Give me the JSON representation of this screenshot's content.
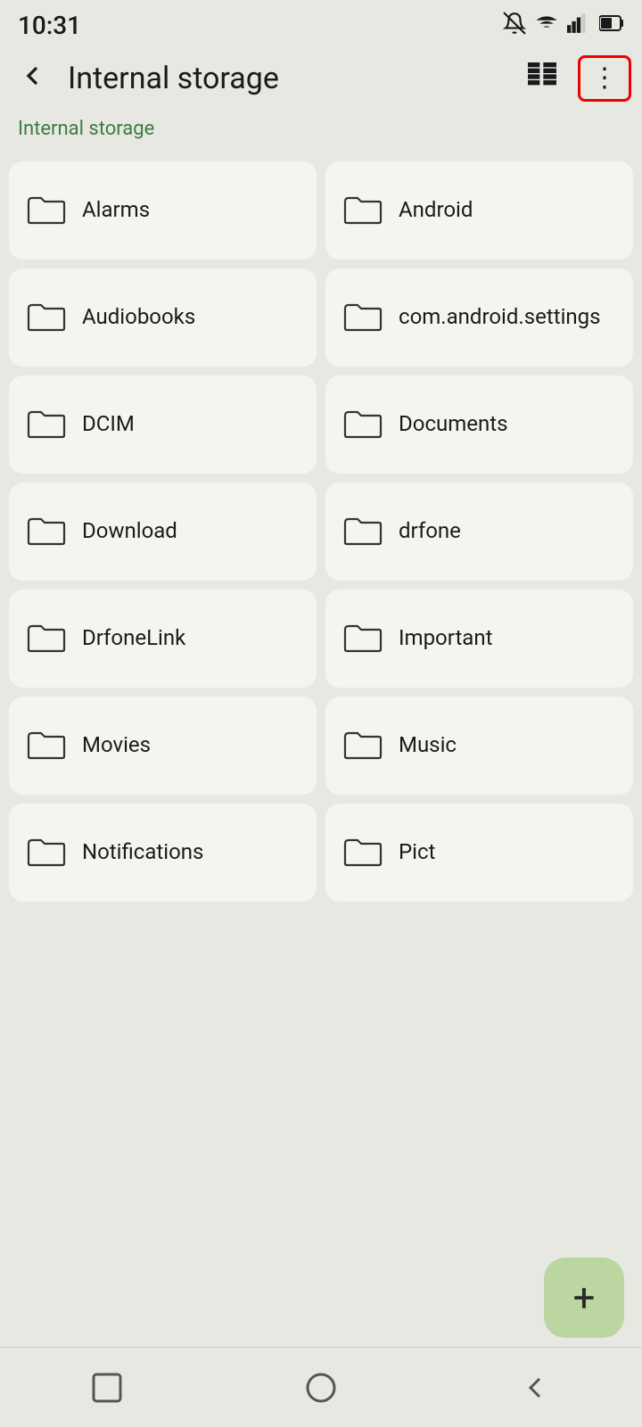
{
  "status": {
    "time": "10:31"
  },
  "topbar": {
    "back_label": "←",
    "title": "Internal storage",
    "more_icon": "⋮"
  },
  "breadcrumb": {
    "text": "Internal storage"
  },
  "folders": [
    {
      "name": "Alarms"
    },
    {
      "name": "Android"
    },
    {
      "name": "Audiobooks"
    },
    {
      "name": "com.android.settings"
    },
    {
      "name": "DCIM"
    },
    {
      "name": "Documents"
    },
    {
      "name": "Download"
    },
    {
      "name": "drfone"
    },
    {
      "name": "DrfoneLink"
    },
    {
      "name": "Important"
    },
    {
      "name": "Movies"
    },
    {
      "name": "Music"
    },
    {
      "name": "Notifications"
    },
    {
      "name": "Pict"
    }
  ],
  "fab": {
    "label": "+"
  },
  "navbar": {
    "square_label": "□",
    "circle_label": "○",
    "back_label": "◁"
  }
}
